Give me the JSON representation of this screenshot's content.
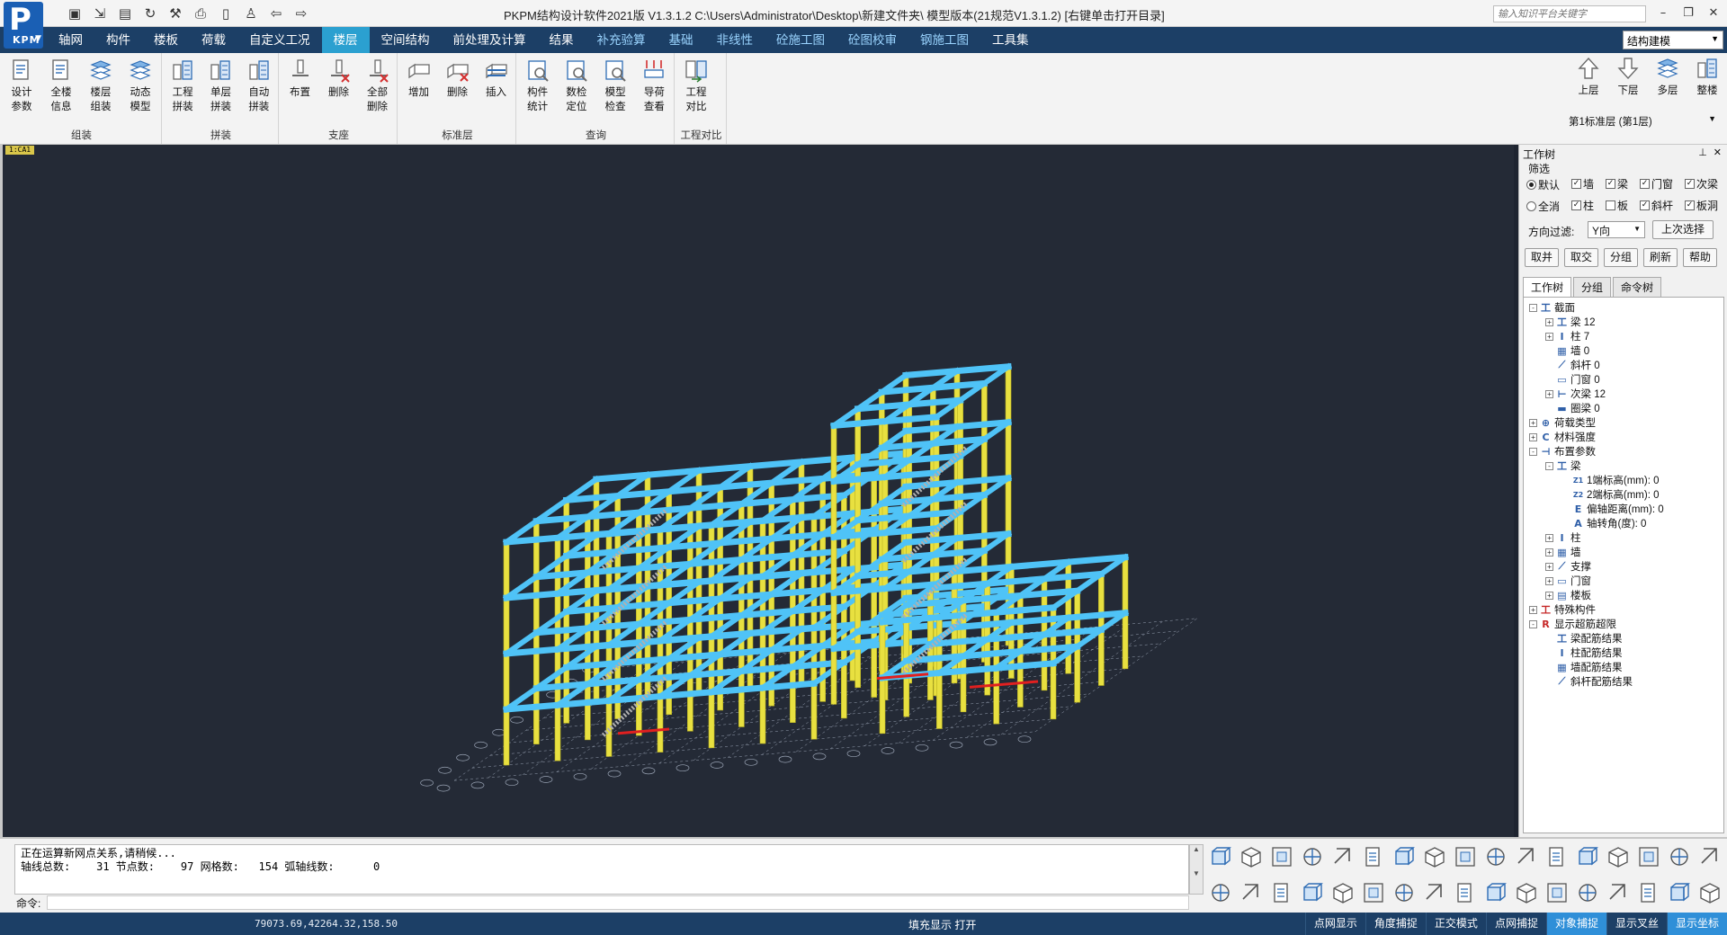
{
  "app": {
    "logo_text": "P",
    "logo_sub": "KPM",
    "title": "PKPM结构设计软件2021版 V1.3.1.2 C:\\Users\\Administrator\\Desktop\\新建文件夹\\  模型版本(21规范V1.3.1.2)   [右键单击打开目录]",
    "search_placeholder": "输入知识平台关键字"
  },
  "menu": {
    "items": [
      "轴网",
      "构件",
      "楼板",
      "荷载",
      "自定义工况",
      "楼层",
      "空间结构",
      "前处理及计算",
      "结果",
      "补充验算",
      "基础",
      "非线性",
      "砼施工图",
      "砼图校审",
      "钢施工图",
      "工具集"
    ],
    "active": "楼层",
    "mode": "结构建模"
  },
  "ribbon": {
    "groups": [
      {
        "label": "组装",
        "buttons": [
          {
            "l1": "设计",
            "l2": "参数",
            "icon": "design-params"
          },
          {
            "l1": "全楼",
            "l2": "信息",
            "icon": "building-info"
          },
          {
            "l1": "楼层",
            "l2": "组装",
            "icon": "floor-assemble"
          },
          {
            "l1": "动态",
            "l2": "模型",
            "icon": "dynamic-model"
          }
        ]
      },
      {
        "label": "拼装",
        "buttons": [
          {
            "l1": "工程",
            "l2": "拼装",
            "icon": "project-assemble"
          },
          {
            "l1": "单层",
            "l2": "拼装",
            "icon": "single-floor-assemble"
          },
          {
            "l1": "自动",
            "l2": "拼装",
            "icon": "auto-assemble"
          }
        ]
      },
      {
        "label": "支座",
        "buttons": [
          {
            "l1": "布置",
            "l2": "",
            "icon": "support-place"
          },
          {
            "l1": "删除",
            "l2": "",
            "icon": "support-delete"
          },
          {
            "l1": "全部",
            "l2": "删除",
            "icon": "support-delete-all"
          }
        ]
      },
      {
        "label": "标准层",
        "buttons": [
          {
            "l1": "增加",
            "l2": "",
            "icon": "floor-add"
          },
          {
            "l1": "删除",
            "l2": "",
            "icon": "floor-delete"
          },
          {
            "l1": "插入",
            "l2": "",
            "icon": "floor-insert"
          }
        ]
      },
      {
        "label": "查询",
        "buttons": [
          {
            "l1": "构件",
            "l2": "统计",
            "icon": "member-stats"
          },
          {
            "l1": "数检",
            "l2": "定位",
            "icon": "check-locate"
          },
          {
            "l1": "模型",
            "l2": "检查",
            "icon": "model-check"
          },
          {
            "l1": "导荷",
            "l2": "查看",
            "icon": "load-view"
          }
        ]
      },
      {
        "label": "工程对比",
        "buttons": [
          {
            "l1": "工程",
            "l2": "对比",
            "icon": "project-compare"
          }
        ]
      }
    ],
    "floor_nav": [
      {
        "label": "上层",
        "icon": "arrow-up"
      },
      {
        "label": "下层",
        "icon": "arrow-down"
      },
      {
        "label": "多层",
        "icon": "multi-floor"
      },
      {
        "label": "整楼",
        "icon": "whole-building"
      }
    ],
    "floor_select": "第1标准层 (第1层)"
  },
  "viewport": {
    "tab_label": "1:CA1"
  },
  "panel": {
    "title": "工作树",
    "filter_label": "筛选",
    "radio_default": "默认",
    "radio_all": "全消",
    "checks_row1": [
      "墙",
      "梁",
      "门窗",
      "次梁"
    ],
    "checks_row2": [
      "柱",
      "板",
      "斜杆",
      "板洞"
    ],
    "checks_row2_states": [
      true,
      false,
      true,
      true
    ],
    "dir_label": "方向过滤:",
    "dir_value": "Y向",
    "last_select": "上次选择",
    "buttons": [
      "取并",
      "取交",
      "分组",
      "刷新",
      "帮助"
    ],
    "tabs": [
      "工作树",
      "分组",
      "命令树"
    ],
    "tree": [
      {
        "level": 0,
        "tog": "-",
        "icon": "section-icon",
        "glyph": "工",
        "text": "截面"
      },
      {
        "level": 1,
        "tog": "+",
        "icon": "beam-icon",
        "glyph": "工",
        "text": "梁 12"
      },
      {
        "level": 1,
        "tog": "+",
        "icon": "column-icon",
        "glyph": "I",
        "text": "柱 7"
      },
      {
        "level": 1,
        "tog": "",
        "icon": "wall-icon",
        "glyph": "▦",
        "text": "墙 0"
      },
      {
        "level": 1,
        "tog": "",
        "icon": "brace-icon",
        "glyph": "⟋",
        "text": "斜杆 0"
      },
      {
        "level": 1,
        "tog": "",
        "icon": "window-icon",
        "glyph": "▭",
        "text": "门窗 0"
      },
      {
        "level": 1,
        "tog": "+",
        "icon": "secondary-beam-icon",
        "glyph": "⊢",
        "text": "次梁 12"
      },
      {
        "level": 1,
        "tog": "",
        "icon": "ring-beam-icon",
        "glyph": "▬",
        "text": "圈梁 0"
      },
      {
        "level": 0,
        "tog": "+",
        "icon": "load-type-icon",
        "glyph": "⊕",
        "text": "荷载类型"
      },
      {
        "level": 0,
        "tog": "+",
        "icon": "material-icon",
        "glyph": "C",
        "text": "材料强度"
      },
      {
        "level": 0,
        "tog": "-",
        "icon": "layout-params-icon",
        "glyph": "⊣",
        "text": "布置参数"
      },
      {
        "level": 1,
        "tog": "-",
        "icon": "beam-icon",
        "glyph": "工",
        "text": "梁"
      },
      {
        "level": 2,
        "tog": "",
        "icon": "z1-icon",
        "glyph": "Z1",
        "text": "1端标高(mm):  0"
      },
      {
        "level": 2,
        "tog": "",
        "icon": "z2-icon",
        "glyph": "Z2",
        "text": "2端标高(mm):  0"
      },
      {
        "level": 2,
        "tog": "",
        "icon": "eccentric-icon",
        "glyph": "E",
        "text": "偏轴距离(mm):  0"
      },
      {
        "level": 2,
        "tog": "",
        "icon": "rotation-icon",
        "glyph": "A",
        "text": "轴转角(度):  0"
      },
      {
        "level": 1,
        "tog": "+",
        "icon": "column-icon",
        "glyph": "I",
        "text": "柱"
      },
      {
        "level": 1,
        "tog": "+",
        "icon": "wall-icon",
        "glyph": "▦",
        "text": "墙"
      },
      {
        "level": 1,
        "tog": "+",
        "icon": "support-icon",
        "glyph": "⟋",
        "text": "支撑"
      },
      {
        "level": 1,
        "tog": "+",
        "icon": "window-icon",
        "glyph": "▭",
        "text": "门窗"
      },
      {
        "level": 1,
        "tog": "+",
        "icon": "slab-icon",
        "glyph": "▤",
        "text": "楼板"
      },
      {
        "level": 0,
        "tog": "+",
        "icon": "special-member-icon",
        "glyph": "工",
        "text": "特殊构件",
        "red": true
      },
      {
        "level": 0,
        "tog": "-",
        "icon": "overlimit-icon",
        "glyph": "R",
        "text": "显示超筋超限",
        "red": true
      },
      {
        "level": 1,
        "tog": "",
        "icon": "beam-rebar-icon",
        "glyph": "工",
        "text": "梁配筋结果"
      },
      {
        "level": 1,
        "tog": "",
        "icon": "column-rebar-icon",
        "glyph": "I",
        "text": "柱配筋结果"
      },
      {
        "level": 1,
        "tog": "",
        "icon": "wall-rebar-icon",
        "glyph": "▦",
        "text": "墙配筋结果"
      },
      {
        "level": 1,
        "tog": "",
        "icon": "brace-rebar-icon",
        "glyph": "⟋",
        "text": "斜杆配筋结果"
      }
    ]
  },
  "command": {
    "line1": "正在运算新网点关系,请稍候...",
    "line2": "轴线总数:    31 节点数:    97 网格数:   154 弧轴线数:      0",
    "prompt": "命令:"
  },
  "status": {
    "coords": "79073.69,42264.32,158.50",
    "fill_display": "填充显示  打开",
    "buttons": [
      "点网显示",
      "角度捕捉",
      "正交模式",
      "点网捕捉",
      "对象捕捉",
      "显示叉丝",
      "显示坐标"
    ],
    "buttons_on": [
      false,
      false,
      false,
      false,
      true,
      false,
      true
    ]
  },
  "colors": {
    "menubar": "#1c3f66",
    "active_tab": "#2ba0d0",
    "viewport_bg": "#242a36",
    "beam": "#4fc3f7",
    "column": "#e8e040",
    "stair": "#b0b0b0",
    "highlight": "#e02020"
  }
}
